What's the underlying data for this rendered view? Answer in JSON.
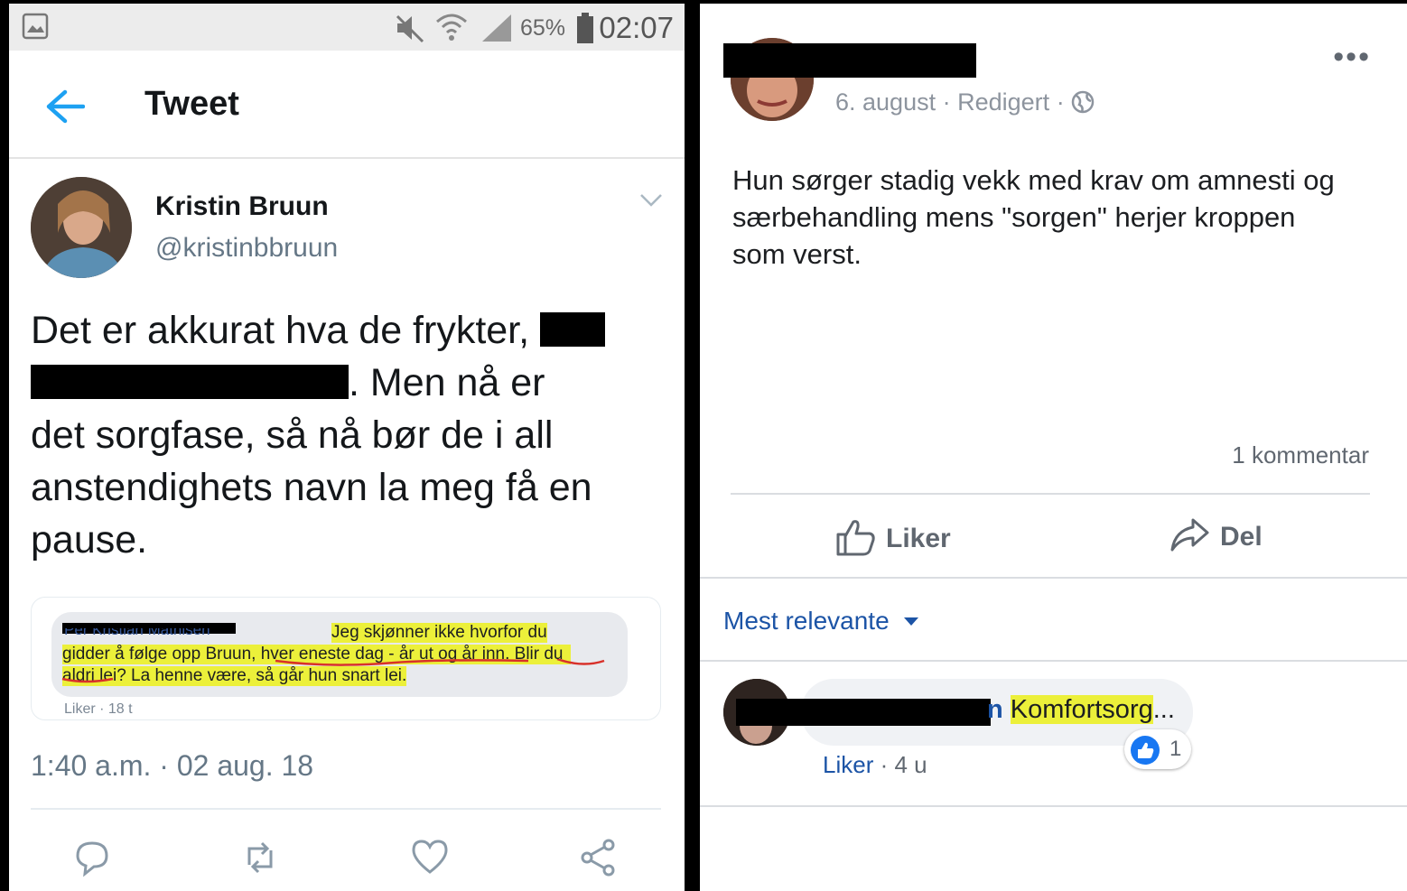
{
  "twitter": {
    "status_bar": {
      "battery_percent": "65%",
      "time": "02:07"
    },
    "header": {
      "title": "Tweet"
    },
    "author": {
      "name": "Kristin Bruun",
      "handle": "@kristinbbruun"
    },
    "tweet": {
      "line1": "Det er akkurat hva de frykter,",
      "line2_tail": ". Men nå er",
      "line3": "det sorgfase, så nå bør de i all",
      "line4": "anstendighets navn la meg få en",
      "line5": "pause."
    },
    "quoted_comment": {
      "author_partial": "Per Kristian Mathisen",
      "line1": "Jeg skjønner ikke hvorfor du",
      "line2": "gidder å følge opp Bruun, hver eneste dag - år ut og år inn. Blir du",
      "line3": "aldri lei? La henne være, så går hun snart lei.",
      "meta": "Liker · 18 t"
    },
    "timestamp": "1:40 a.m. · 02 aug. 18",
    "accent_color": "#1da1f2"
  },
  "facebook": {
    "post": {
      "date": "6. august",
      "edited": "Redigert",
      "text_line1": "Hun sørger stadig vekk med krav om amnesti og",
      "text_line2": "særbehandling mens \"sorgen\" herjer kroppen",
      "text_line3": "som verst."
    },
    "comment_count": "1 kommentar",
    "actions": {
      "like": "Liker",
      "share": "Del"
    },
    "sort_label": "Mest relevante",
    "comment": {
      "name_tail": "n",
      "text": "Komfortsorg",
      "ellipsis": "...",
      "like_link": "Liker",
      "age": "· 4 u",
      "reaction_count": "1"
    },
    "link_color": "#1c54a6"
  }
}
